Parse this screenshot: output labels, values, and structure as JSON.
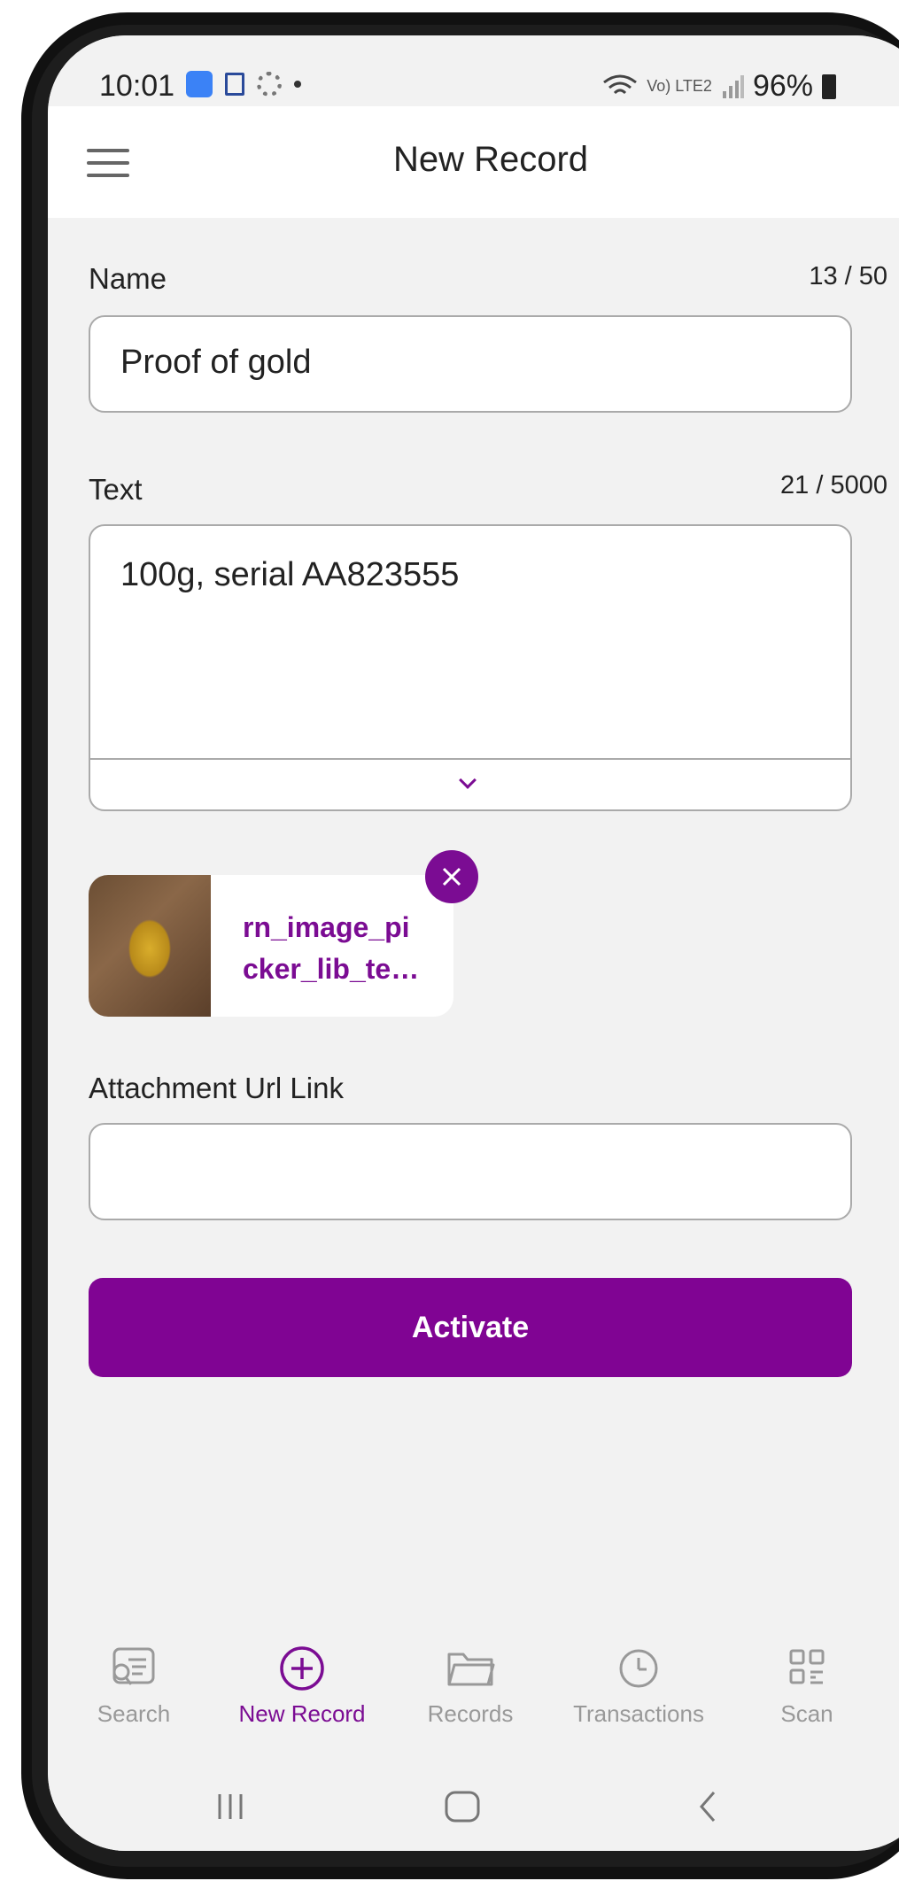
{
  "status_bar": {
    "time": "10:01",
    "battery": "96%",
    "network": "Vo) LTE2"
  },
  "app_bar": {
    "title": "New Record"
  },
  "form": {
    "name": {
      "label": "Name",
      "counter": "13 / 50",
      "value": "Proof of gold"
    },
    "text": {
      "label": "Text",
      "counter": "21 / 5000",
      "value": "100g, serial AA823555"
    },
    "attachment": {
      "file_name": "rn_image_pi cker_lib_te…"
    },
    "url_link": {
      "label": "Attachment Url Link",
      "value": ""
    },
    "activate_label": "Activate"
  },
  "bottom_nav": {
    "items": [
      {
        "label": "Search",
        "icon": "search-doc-icon",
        "active": false
      },
      {
        "label": "New Record",
        "icon": "plus-circle-icon",
        "active": true
      },
      {
        "label": "Records",
        "icon": "folder-icon",
        "active": false
      },
      {
        "label": "Transactions",
        "icon": "clock-icon",
        "active": false
      },
      {
        "label": "Scan",
        "icon": "qr-code-icon",
        "active": false
      }
    ]
  },
  "colors": {
    "accent": "#800493",
    "background": "#f2f2f2",
    "inactive": "#999999"
  }
}
